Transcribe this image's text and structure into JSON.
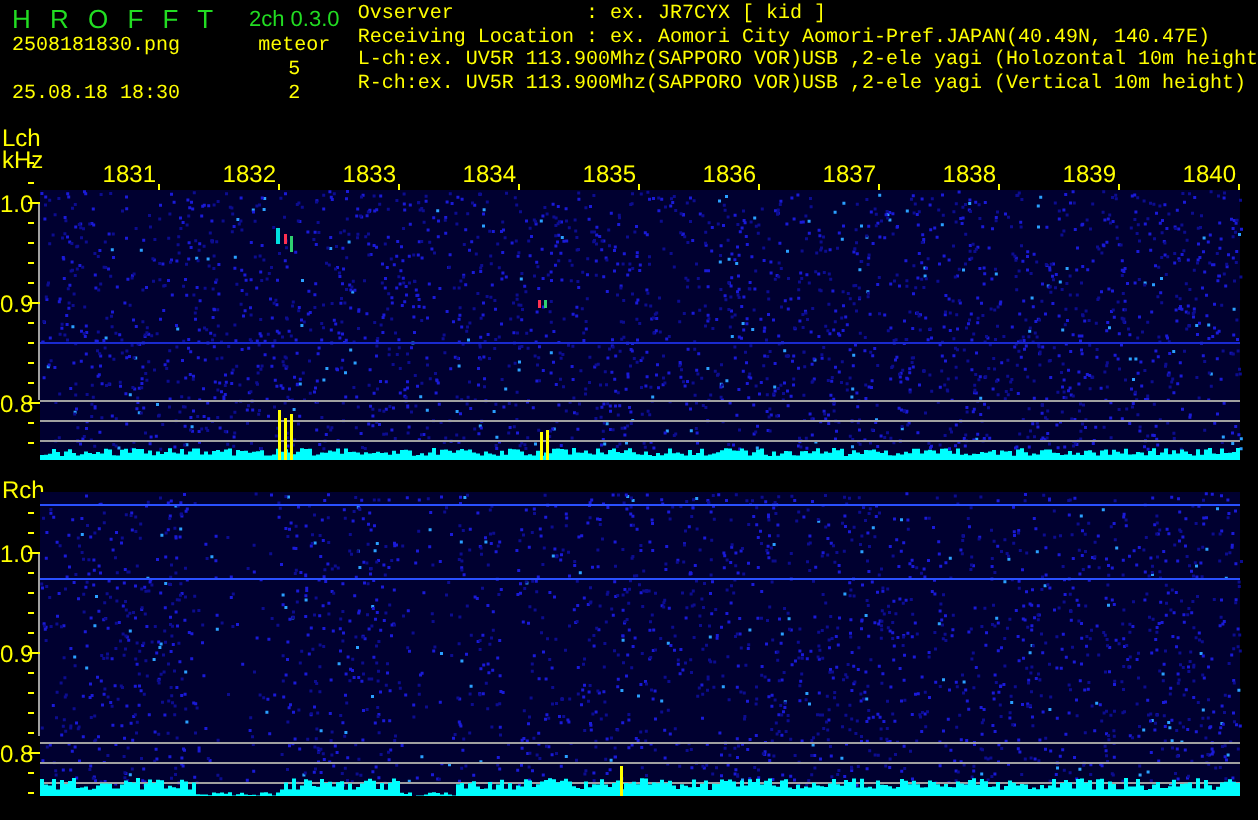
{
  "header": {
    "title": "H R O F F T",
    "filename": "2508181830.png",
    "datetime": "25.08.18 18:30",
    "version": "2ch 0.3.0",
    "meteor_label": "meteor",
    "meteor_counts": [
      "5",
      "2"
    ],
    "info_lines": [
      "Ovserver           : ex. JR7CYX [ kid ]",
      "Receiving Location : ex. Aomori City Aomori-Pref.JAPAN(40.49N, 140.47E)",
      "L-ch:ex. UV5R 113.900Mhz(SAPPORO VOR)USB ,2-ele yagi (Holozontal 10m height",
      "R-ch:ex. UV5R 113.900Mhz(SAPPORO VOR)USB ,2-ele yagi (Vertical 10m height)"
    ]
  },
  "time_labels": [
    "1831",
    "1832",
    "1833",
    "1834",
    "1835",
    "1836",
    "1837",
    "1838",
    "1839",
    "1840"
  ],
  "channels": [
    {
      "label": "Lch",
      "unit": "kHz",
      "yticks": [
        "1.0",
        "0.9",
        "0.8"
      ]
    },
    {
      "label": "Rch",
      "yticks": [
        "1.0",
        "0.9",
        "0.8"
      ]
    }
  ]
}
